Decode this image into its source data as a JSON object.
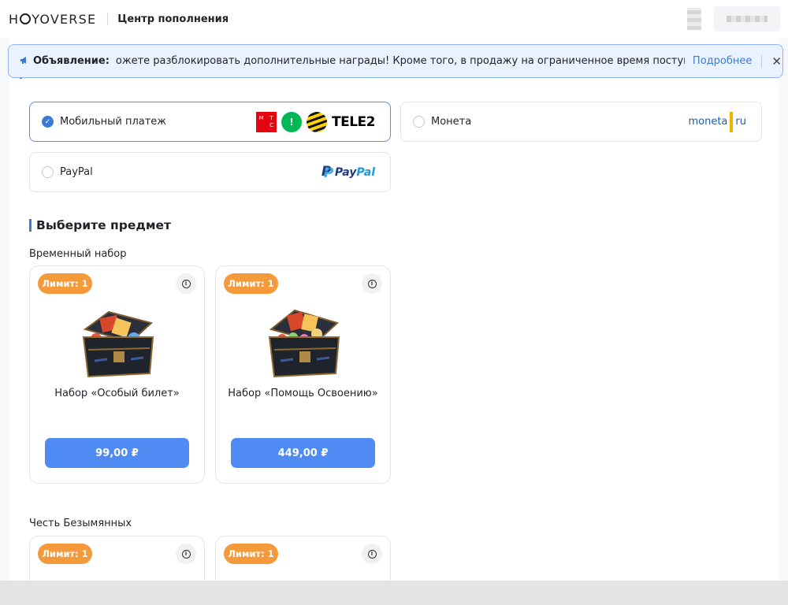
{
  "header": {
    "logo": "HOYOVERSE",
    "title": "Центр пополнения"
  },
  "announcement": {
    "label": "Объявление:",
    "text": "ожете разблокировать дополнительные награды! Кроме того, в продажу на ограниченное время поступят подарочн",
    "more": "Подробнее",
    "close": "✕"
  },
  "payment": {
    "methods": [
      {
        "label": "Мобильный платеж",
        "selected": true
      },
      {
        "label": "Монета",
        "selected": false
      },
      {
        "label": "PayPal",
        "selected": false
      }
    ],
    "logos": {
      "mts": [
        "М",
        "Т",
        "",
        "С"
      ],
      "megafon": "!",
      "tele2": "TELE2",
      "moneta_left": "moneta",
      "moneta_right": "ru",
      "paypal_1": "Pay",
      "paypal_2": "Pal"
    }
  },
  "select_title": "Выберите предмет",
  "groups": [
    {
      "label": "Временный набор",
      "items": [
        {
          "badge": "Лимит: 1",
          "name": "Набор «Особый билет»",
          "price": "99,00 ₽"
        },
        {
          "badge": "Лимит: 1",
          "name": "Набор «Помощь Освоению»",
          "price": "449,00 ₽"
        }
      ]
    },
    {
      "label": "Честь Безымянных",
      "items": [
        {
          "badge": "Лимит: 1"
        },
        {
          "badge": "Лимит: 1"
        }
      ]
    }
  ],
  "icons": {
    "megaphone": "megaphone-icon",
    "close": "close-icon",
    "info": "info-icon",
    "check": "check-icon"
  },
  "colors": {
    "accent": "#3a7bd5",
    "button": "#4f8bf3",
    "badge": "#f59a3b",
    "announce_bg": "#eaf2ff"
  }
}
